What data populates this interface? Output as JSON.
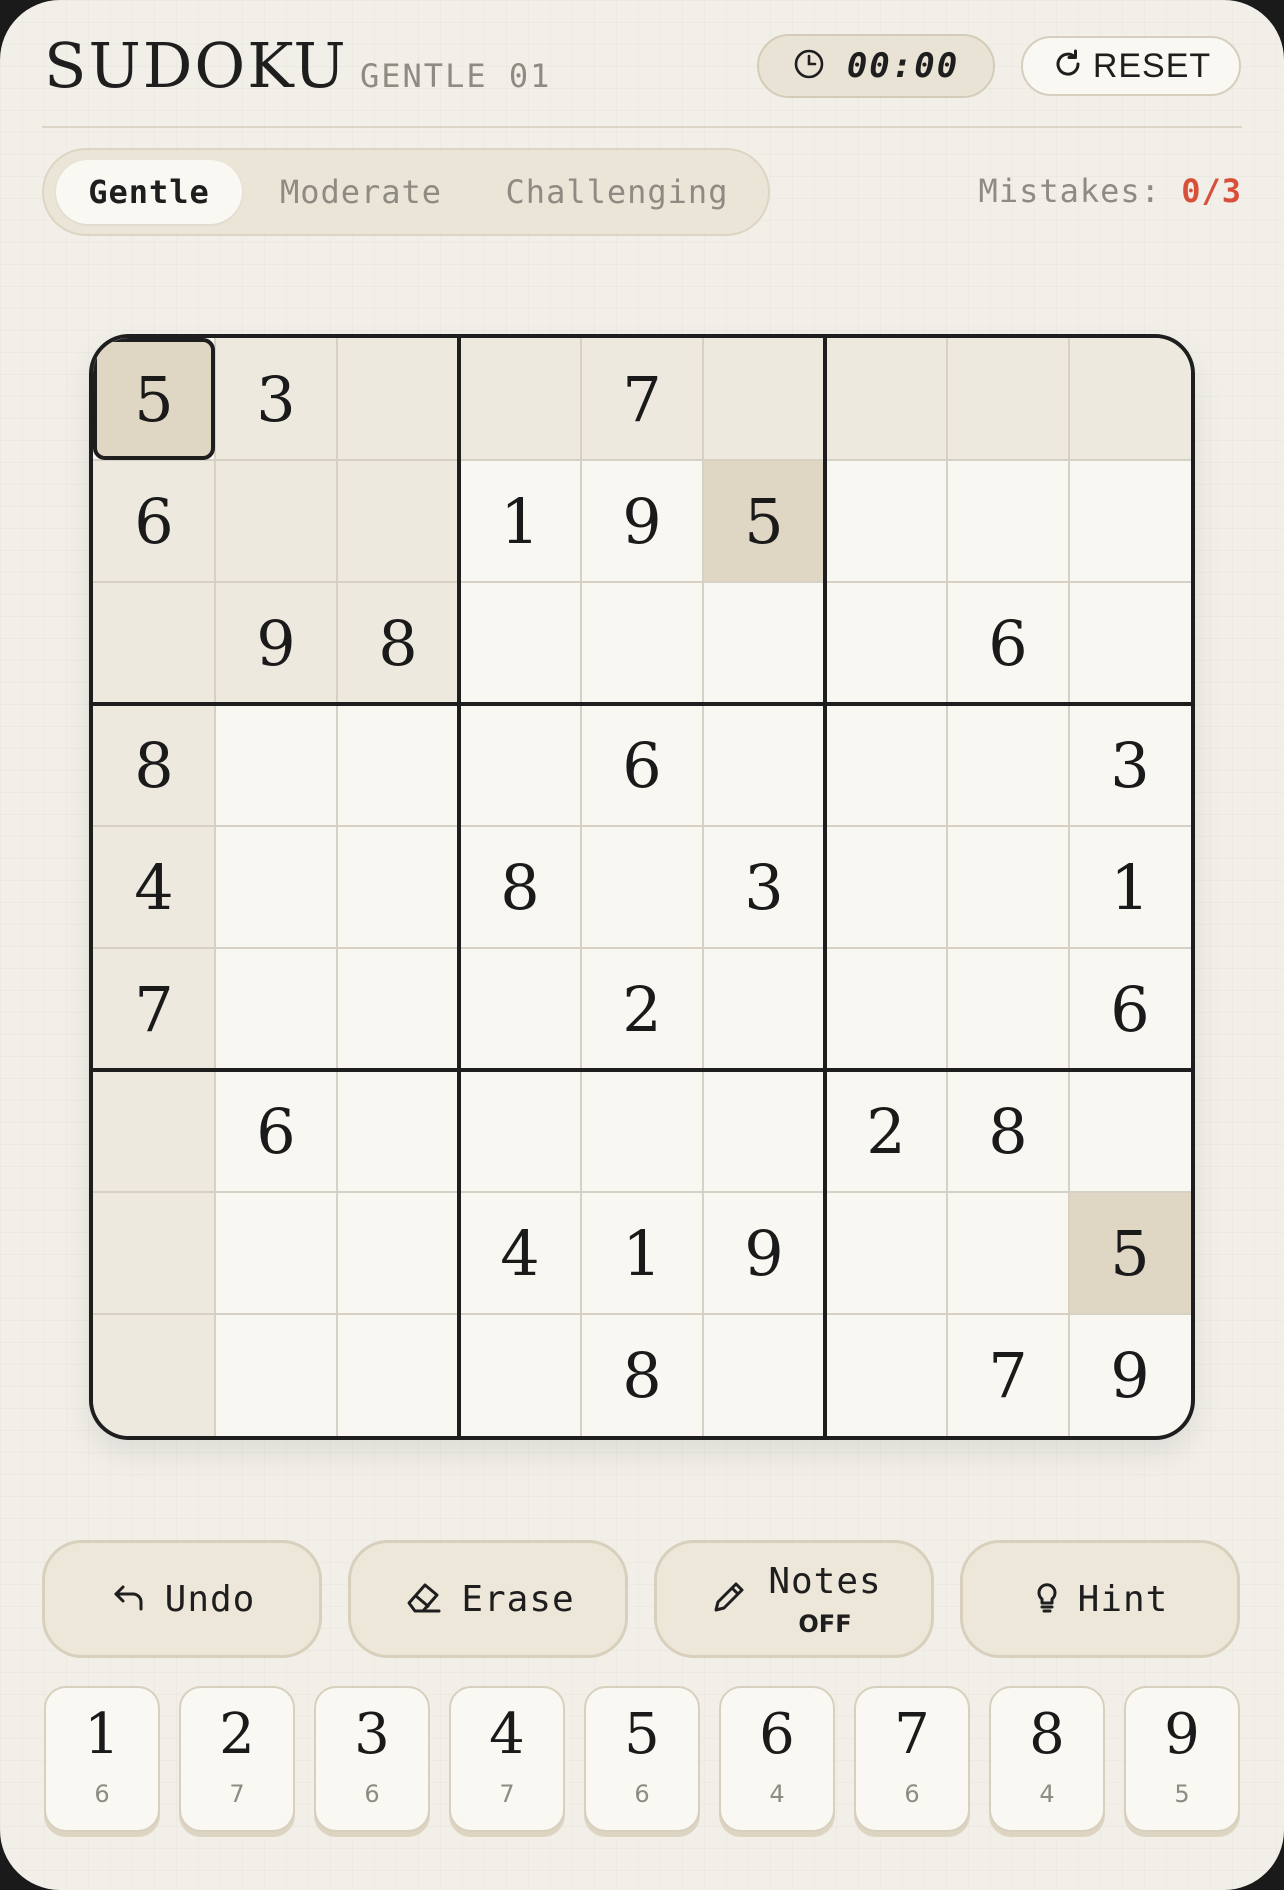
{
  "header": {
    "title": "SUDOKU",
    "subtitle": "GENTLE 01",
    "timer": "00:00",
    "reset_label": "RESET"
  },
  "difficulty": {
    "tabs": [
      {
        "label": "Gentle",
        "active": true
      },
      {
        "label": "Moderate",
        "active": false
      },
      {
        "label": "Challenging",
        "active": false
      }
    ]
  },
  "mistakes": {
    "label": "Mistakes:",
    "value": "0/3"
  },
  "board": {
    "selected_cell": [
      0,
      0
    ],
    "rows": [
      [
        "5",
        "3",
        "",
        "",
        "7",
        "",
        "",
        "",
        ""
      ],
      [
        "6",
        "",
        "",
        "1",
        "9",
        "5",
        "",
        "",
        ""
      ],
      [
        "",
        "9",
        "8",
        "",
        "",
        "",
        "",
        "6",
        ""
      ],
      [
        "8",
        "",
        "",
        "",
        "6",
        "",
        "",
        "",
        "3"
      ],
      [
        "4",
        "",
        "",
        "8",
        "",
        "3",
        "",
        "",
        "1"
      ],
      [
        "7",
        "",
        "",
        "",
        "2",
        "",
        "",
        "",
        "6"
      ],
      [
        "",
        "6",
        "",
        "",
        "",
        "",
        "2",
        "8",
        ""
      ],
      [
        "",
        "",
        "",
        "4",
        "1",
        "9",
        "",
        "",
        "5"
      ],
      [
        "",
        "",
        "",
        "",
        "8",
        "",
        "",
        "7",
        "9"
      ]
    ]
  },
  "actions": {
    "undo_label": "Undo",
    "erase_label": "Erase",
    "notes_label": "Notes",
    "notes_state": "OFF",
    "hint_label": "Hint"
  },
  "keypad": [
    {
      "digit": "1",
      "remaining": "6"
    },
    {
      "digit": "2",
      "remaining": "7"
    },
    {
      "digit": "3",
      "remaining": "6"
    },
    {
      "digit": "4",
      "remaining": "7"
    },
    {
      "digit": "5",
      "remaining": "6"
    },
    {
      "digit": "6",
      "remaining": "4"
    },
    {
      "digit": "7",
      "remaining": "6"
    },
    {
      "digit": "8",
      "remaining": "4"
    },
    {
      "digit": "9",
      "remaining": "5"
    }
  ],
  "colors": {
    "accent_mistakes": "#d9503a",
    "highlight": "#ede9df",
    "same_number": "#dfd7c4"
  },
  "icons": {
    "timer": "clock-icon",
    "reset": "refresh-icon",
    "undo": "undo-arrow-icon",
    "erase": "eraser-icon",
    "notes": "pencil-icon",
    "hint": "lightbulb-icon"
  }
}
